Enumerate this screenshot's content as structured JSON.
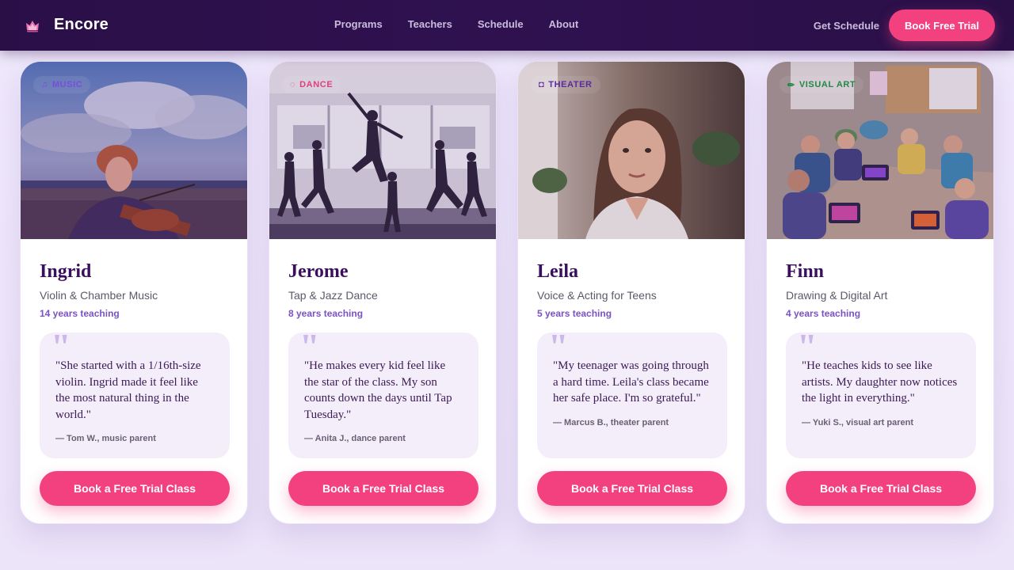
{
  "nav": {
    "brand": "Encore",
    "brand_icon": "crown-icon",
    "links": [
      "Programs",
      "Teachers",
      "Schedule",
      "About"
    ],
    "get_schedule": "Get Schedule",
    "cta": "Book Free Trial"
  },
  "colors": {
    "nav_bg": "#2a0f47",
    "accent": "#f2417e",
    "name": "#3a0f5e",
    "years": "#7a52c4",
    "quote_bg": "#f4eefa"
  },
  "teachers": [
    {
      "tag": "MUSIC",
      "tag_icon": "music-note-icon",
      "tag_color": "#7b4be0",
      "name": "Ingrid",
      "subject": "Violin & Chamber Music",
      "years": "14 years teaching",
      "quote": "\"She started with a 1/16th-size violin. Ingrid made it feel like the most natural thing in the world.\"",
      "author": "— Tom W., music parent",
      "cta": "Book a Free Trial Class",
      "photo": "violinist-outdoors-photo"
    },
    {
      "tag": "DANCE",
      "tag_icon": "dance-icon",
      "tag_color": "#e0407a",
      "name": "Jerome",
      "subject": "Tap & Jazz Dance",
      "years": "8 years teaching",
      "quote": "\"He makes every kid feel like the star of the class. My son counts down the days until Tap Tuesday.\"",
      "author": "— Anita J., dance parent",
      "cta": "Book a Free Trial Class",
      "photo": "dancers-studio-photo"
    },
    {
      "tag": "THEATER",
      "tag_icon": "theater-masks-icon",
      "tag_color": "#5b2aa0",
      "name": "Leila",
      "subject": "Voice & Acting for Teens",
      "years": "5 years teaching",
      "quote": "\"My teenager was going through a hard time. Leila's class became her safe place. I'm so grateful.\"",
      "author": "— Marcus B., theater parent",
      "cta": "Book a Free Trial Class",
      "photo": "teacher-portrait-photo"
    },
    {
      "tag": "VISUAL ART",
      "tag_icon": "pencil-icon",
      "tag_color": "#1f8a45",
      "name": "Finn",
      "subject": "Drawing & Digital Art",
      "years": "4 years teaching",
      "quote": "\"He teaches kids to see like artists. My daughter now notices the light in everything.\"",
      "author": "— Yuki S., visual art parent",
      "cta": "Book a Free Trial Class",
      "photo": "kids-classroom-tablets-photo"
    }
  ]
}
